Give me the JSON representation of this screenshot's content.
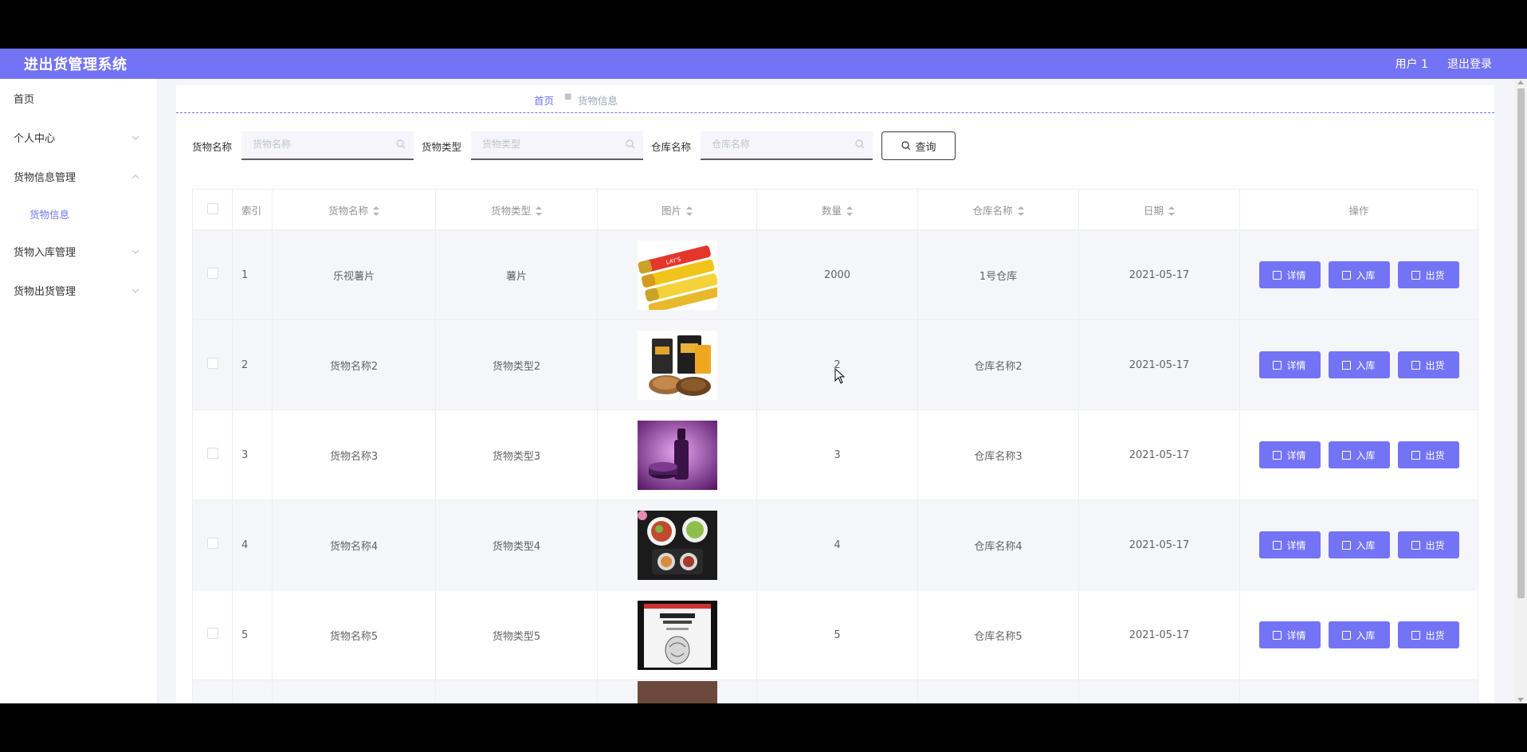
{
  "header": {
    "title": "进出货管理系统",
    "user": "用户 1",
    "logout": "退出登录"
  },
  "sidebar": {
    "items": [
      {
        "label": "首页"
      },
      {
        "label": "个人中心"
      },
      {
        "label": "货物信息管理",
        "children": [
          {
            "label": "货物信息"
          }
        ]
      },
      {
        "label": "货物入库管理"
      },
      {
        "label": "货物出货管理"
      }
    ]
  },
  "breadcrumb": {
    "home": "首页",
    "current": "货物信息"
  },
  "search": {
    "fields": [
      {
        "label": "货物名称",
        "placeholder": "货物名称"
      },
      {
        "label": "货物类型",
        "placeholder": "货物类型"
      },
      {
        "label": "仓库名称",
        "placeholder": "仓库名称"
      }
    ],
    "button": "查询"
  },
  "table": {
    "columns": [
      "索引",
      "货物名称",
      "货物类型",
      "图片",
      "数量",
      "仓库名称",
      "日期",
      "操作"
    ],
    "rows": [
      {
        "index": "1",
        "name": "乐视薯片",
        "type": "薯片",
        "image": "chips-product-image",
        "quantity": "2000",
        "warehouse": "1号仓库",
        "date": "2021-05-17"
      },
      {
        "index": "2",
        "name": "货物名称2",
        "type": "货物类型2",
        "image": "snacks-product-image",
        "quantity": "2",
        "warehouse": "仓库名称2",
        "date": "2021-05-17"
      },
      {
        "index": "3",
        "name": "货物名称3",
        "type": "货物类型3",
        "image": "cosmetics-product-image",
        "quantity": "3",
        "warehouse": "仓库名称3",
        "date": "2021-05-17"
      },
      {
        "index": "4",
        "name": "货物名称4",
        "type": "货物类型4",
        "image": "food-dishes-product-image",
        "quantity": "4",
        "warehouse": "仓库名称4",
        "date": "2021-05-17"
      },
      {
        "index": "5",
        "name": "货物名称5",
        "type": "货物类型5",
        "image": "book-product-image",
        "quantity": "5",
        "warehouse": "仓库名称5",
        "date": "2021-05-17"
      }
    ],
    "actions": {
      "detail": "详情",
      "in": "入库",
      "out": "出货"
    }
  },
  "colors": {
    "accent": "#7373f5",
    "row_alt": "#f5f6fa"
  }
}
